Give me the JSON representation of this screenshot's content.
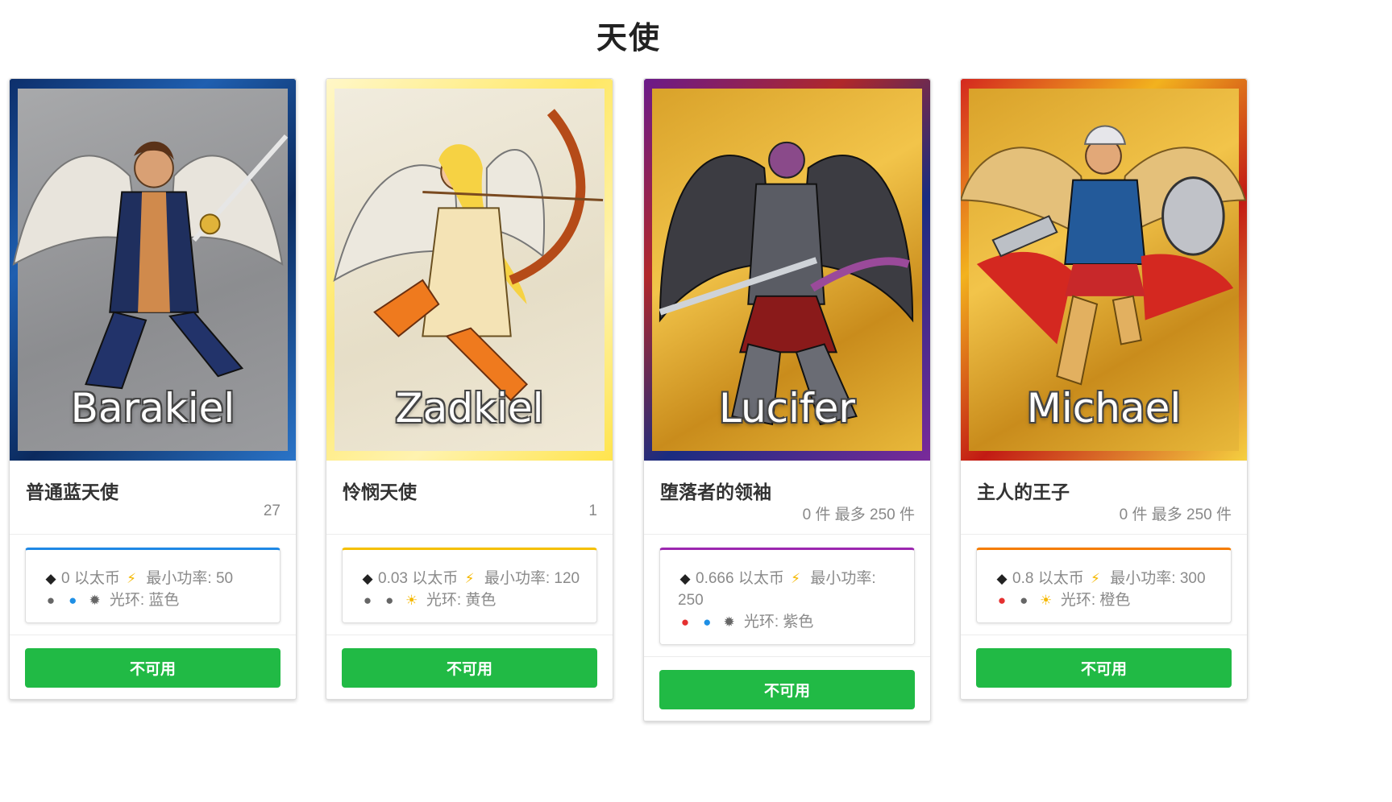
{
  "page": {
    "title": "天使"
  },
  "cards": [
    {
      "art_name": "Barakiel",
      "title": "普通蓝天使",
      "count": "27",
      "stats": {
        "price": "0 以太币",
        "power_label": "最小功率:",
        "power": "50",
        "halo_label": "光环:",
        "halo": "蓝色"
      },
      "accent": "#1e88e5",
      "button": "不可用"
    },
    {
      "art_name": "Zadkiel",
      "title": "怜悯天使",
      "count": "1",
      "stats": {
        "price": "0.03 以太币",
        "power_label": "最小功率:",
        "power": "120",
        "halo_label": "光环:",
        "halo": "黄色"
      },
      "accent": "#f5c000",
      "button": "不可用"
    },
    {
      "art_name": "Lucifer",
      "title": "堕落者的领袖",
      "count": "0 件 最多 250 件",
      "stats": {
        "price": "0.666 以太币",
        "power_label": "最小功率:",
        "power": "250",
        "halo_label": "光环:",
        "halo": "紫色"
      },
      "accent": "#9c27b0",
      "button": "不可用"
    },
    {
      "art_name": "Michael",
      "title": "主人的王子",
      "count": "0 件 最多 250 件",
      "stats": {
        "price": "0.8 以太币",
        "power_label": "最小功率:",
        "power": "300",
        "halo_label": "光环:",
        "halo": "橙色"
      },
      "accent": "#f57c00",
      "button": "不可用"
    }
  ],
  "icons": {
    "eth": "ethereum-icon",
    "bolt": "lightning-bolt-icon",
    "drop": "flame-drop-icon",
    "gear": "gear-icon",
    "sun": "sun-icon"
  }
}
